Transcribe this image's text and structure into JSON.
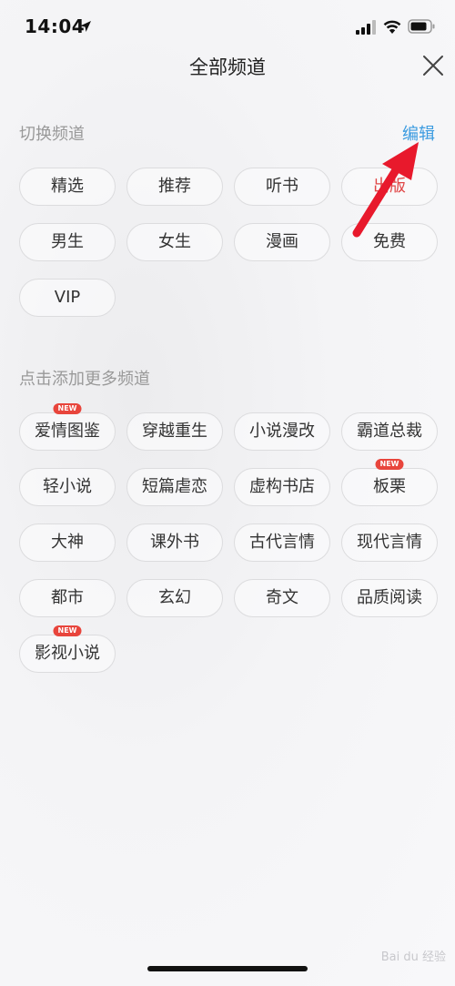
{
  "status_bar": {
    "time": "14:04"
  },
  "header": {
    "title": "全部频道"
  },
  "switch_section": {
    "label": "切换频道",
    "edit_label": "编辑",
    "channels": [
      {
        "label": "精选",
        "color": "normal"
      },
      {
        "label": "推荐",
        "color": "normal"
      },
      {
        "label": "听书",
        "color": "normal"
      },
      {
        "label": "出版",
        "color": "red"
      },
      {
        "label": "男生",
        "color": "normal"
      },
      {
        "label": "女生",
        "color": "normal"
      },
      {
        "label": "漫画",
        "color": "normal"
      },
      {
        "label": "免费",
        "color": "normal"
      },
      {
        "label": "VIP",
        "color": "normal"
      }
    ]
  },
  "add_section": {
    "label": "点击添加更多频道",
    "badge_text": "NEW",
    "channels": [
      {
        "label": "爱情图鉴",
        "new": true
      },
      {
        "label": "穿越重生",
        "new": false
      },
      {
        "label": "小说漫改",
        "new": false
      },
      {
        "label": "霸道总裁",
        "new": false
      },
      {
        "label": "轻小说",
        "new": false
      },
      {
        "label": "短篇虐恋",
        "new": false
      },
      {
        "label": "虚构书店",
        "new": false
      },
      {
        "label": "板栗",
        "new": true
      },
      {
        "label": "大神",
        "new": false
      },
      {
        "label": "课外书",
        "new": false
      },
      {
        "label": "古代言情",
        "new": false
      },
      {
        "label": "现代言情",
        "new": false
      },
      {
        "label": "都市",
        "new": false
      },
      {
        "label": "玄幻",
        "new": false
      },
      {
        "label": "奇文",
        "new": false
      },
      {
        "label": "品质阅读",
        "new": false
      },
      {
        "label": "影视小说",
        "new": true
      }
    ]
  },
  "watermark": {
    "text": "Bai du 经验"
  },
  "colors": {
    "accent": "#3b9be0",
    "badge": "#e8453c",
    "highlight_text": "#e04747",
    "arrow": "#e8192c"
  }
}
